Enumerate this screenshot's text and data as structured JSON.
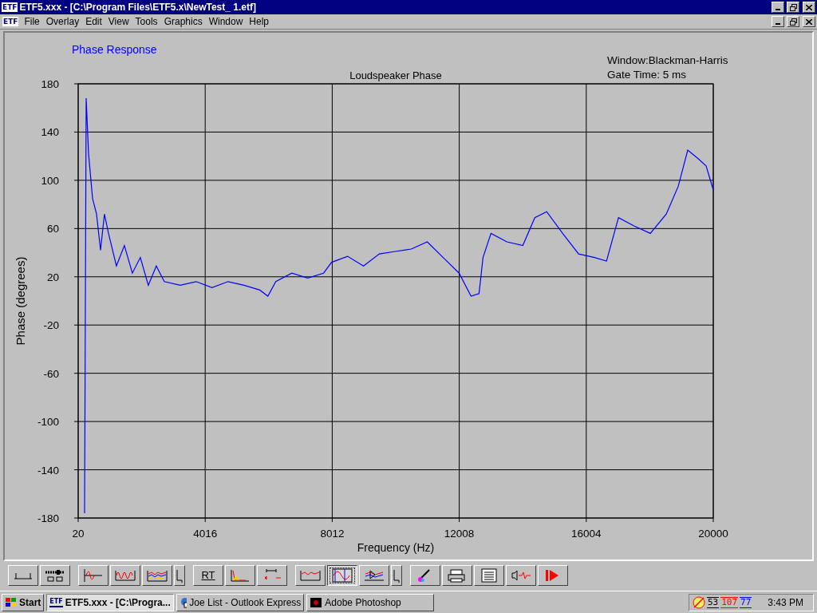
{
  "window": {
    "title": "ETF5.xxx - [C:\\Program Files\\ETF5.x\\NewTest_ 1.etf]",
    "icon_text": "ETF"
  },
  "menu_icon_text": "ETF",
  "menu": [
    {
      "label": "File"
    },
    {
      "label": "Overlay"
    },
    {
      "label": "Edit"
    },
    {
      "label": "View"
    },
    {
      "label": "Tools"
    },
    {
      "label": "Graphics"
    },
    {
      "label": "Window"
    },
    {
      "label": "Help"
    }
  ],
  "view_title": "Phase Response",
  "info": [
    "Window:Blackman-Harris",
    "Gate Time: 5 ms"
  ],
  "chart_data": {
    "type": "line",
    "title": "Loudspeaker Phase",
    "xlabel": "Frequency (Hz)",
    "ylabel": "Phase (degrees)",
    "xlim": [
      20,
      20000
    ],
    "ylim": [
      -180,
      180
    ],
    "grid": true,
    "xticks": [
      {
        "value": 20,
        "label": "20"
      },
      4016,
      8012,
      12008,
      16004,
      20000
    ],
    "yticks": [
      -180,
      -140,
      -100,
      -60,
      -20,
      20,
      60,
      100,
      140,
      180
    ],
    "series": [
      {
        "color": "#0000ff",
        "x": [
          221,
          246,
          271,
          346,
          471,
          597,
          722,
          847,
          973,
          1223,
          1474,
          1725,
          1976,
          2226,
          2477,
          2728,
          3229,
          3730,
          4232,
          4733,
          5235,
          5736,
          5987,
          6238,
          6739,
          7240,
          7742,
          7992,
          8494,
          8995,
          9496,
          9998,
          10499,
          11001,
          11502,
          12003,
          12379,
          12630,
          12755,
          13006,
          13507,
          14008,
          14384,
          14760,
          15262,
          15763,
          16265,
          16641,
          17017,
          17518,
          18019,
          18521,
          18897,
          19198,
          19524,
          19775,
          20000
        ],
        "values": [
          -176,
          -4,
          168,
          122,
          85,
          72,
          42,
          72,
          56,
          29,
          46,
          23,
          36,
          13,
          29,
          16,
          13,
          16,
          11,
          16,
          13,
          9,
          4,
          16,
          23,
          19,
          23,
          32,
          37,
          29,
          39,
          41,
          43,
          49,
          36,
          23,
          4,
          6,
          36,
          56,
          49,
          46,
          69,
          74,
          56,
          39,
          36,
          33,
          69,
          62,
          56,
          72,
          95,
          125,
          118,
          112,
          92
        ]
      }
    ]
  },
  "toolbar": [
    {
      "kind": "icon",
      "selected": false
    },
    {
      "kind": "icon",
      "selected": false
    },
    {
      "kind": "gap"
    },
    {
      "kind": "icon",
      "selected": false
    },
    {
      "kind": "icon",
      "selected": false
    },
    {
      "kind": "icon",
      "selected": false
    },
    {
      "kind": "small",
      "selected": false
    },
    {
      "kind": "gap"
    },
    {
      "kind": "text",
      "label": "RT",
      "selected": false
    },
    {
      "kind": "icon",
      "selected": false
    },
    {
      "kind": "icon",
      "selected": false
    },
    {
      "kind": "gap"
    },
    {
      "kind": "icon",
      "selected": false
    },
    {
      "kind": "icon",
      "selected": true
    },
    {
      "kind": "icon",
      "selected": false
    },
    {
      "kind": "small",
      "selected": false
    },
    {
      "kind": "gap"
    },
    {
      "kind": "icon",
      "selected": false
    },
    {
      "kind": "icon",
      "selected": false
    },
    {
      "kind": "icon",
      "selected": false
    },
    {
      "kind": "icon",
      "selected": false
    },
    {
      "kind": "icon",
      "selected": false
    }
  ],
  "taskbar": {
    "start": "Start",
    "tasks": [
      {
        "label": "ETF5.xxx - [C:\\Progra...",
        "icon_text": "ETF",
        "selected": true
      },
      {
        "label": "Joe List - Outlook Express",
        "selected": false
      },
      {
        "label": "Adobe Photoshop",
        "selected": false
      }
    ],
    "tray": [
      {
        "text": "53",
        "color": "#000000"
      },
      {
        "text": "107",
        "color": "#ff0000"
      },
      {
        "text": "77",
        "color": "#0000ff"
      }
    ],
    "clock": "3:43 PM"
  }
}
